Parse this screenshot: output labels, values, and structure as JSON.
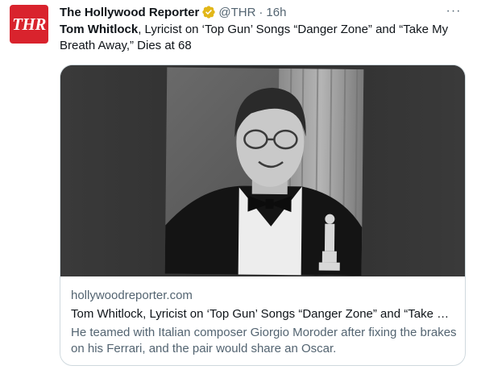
{
  "tweet": {
    "author_name": "The Hollywood Reporter",
    "handle": "@THR",
    "separator": "·",
    "time": "16h",
    "avatar_text": "THR",
    "more_label": "···",
    "text_bold": "Tom Whitlock",
    "text_rest": ", Lyricist on ‘Top Gun’ Songs “Danger Zone” and “Take My Breath Away,” Dies at 68"
  },
  "card": {
    "domain": "hollywoodreporter.com",
    "title": "Tom Whitlock, Lyricist on ‘Top Gun’ Songs “Danger Zone” and “Take My Breath Away,” Dies at 68",
    "description": "He teamed with Italian composer Giorgio Moroder after fixing the brakes on his Ferrari, and the pair would share an Oscar."
  },
  "colors": {
    "avatar_bg": "#d9232d",
    "verified_gold": "#e2b719",
    "secondary_text": "#536471",
    "border": "#cfd9de"
  },
  "icons": {
    "verified": "verified-badge-icon",
    "more": "more-options-icon"
  }
}
